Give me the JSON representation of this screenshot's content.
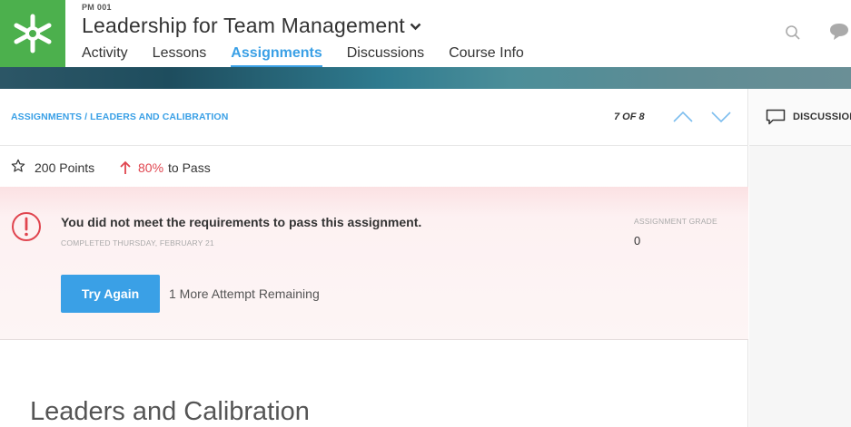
{
  "header": {
    "course_code": "PM 001",
    "course_title": "Leadership for Team Management",
    "nav": [
      {
        "label": "Activity",
        "active": false
      },
      {
        "label": "Lessons",
        "active": false
      },
      {
        "label": "Assignments",
        "active": true
      },
      {
        "label": "Discussions",
        "active": false
      },
      {
        "label": "Course Info",
        "active": false
      }
    ],
    "icons": [
      "logo-icon",
      "search-icon",
      "chat-icon"
    ]
  },
  "assignment": {
    "breadcrumb": "ASSIGNMENTS / LEADERS AND CALIBRATION",
    "counter": "7 OF 8",
    "points": "200 Points",
    "pass_percent": "80%",
    "pass_label": "to Pass"
  },
  "alert": {
    "message": "You did not meet the requirements to pass this assignment.",
    "completed": "COMPLETED THURSDAY, FEBRUARY 21",
    "grade_label": "ASSIGNMENT GRADE",
    "grade_value": "0",
    "try_again_label": "Try Again",
    "attempts_text": "1 More Attempt Remaining"
  },
  "content": {
    "heading": "Leaders and Calibration"
  },
  "side_panel": {
    "label": "DISCUSSIONS"
  },
  "colors": {
    "brand_green": "#4cb04d",
    "accent_blue": "#3aa0e6",
    "alert_red": "#e0454f"
  }
}
